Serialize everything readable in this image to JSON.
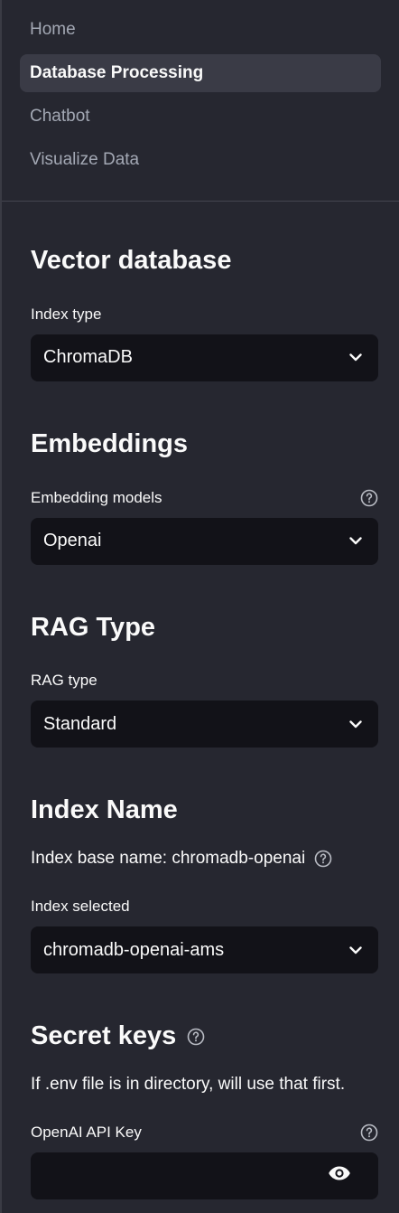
{
  "nav": {
    "items": [
      {
        "label": "Home",
        "active": false
      },
      {
        "label": "Database Processing",
        "active": true
      },
      {
        "label": "Chatbot",
        "active": false
      },
      {
        "label": "Visualize Data",
        "active": false
      }
    ]
  },
  "vector_db": {
    "title": "Vector database",
    "index_type_label": "Index type",
    "index_type_value": "ChromaDB"
  },
  "embeddings": {
    "title": "Embeddings",
    "models_label": "Embedding models",
    "models_value": "Openai"
  },
  "rag": {
    "title": "RAG Type",
    "type_label": "RAG type",
    "type_value": "Standard"
  },
  "index_name": {
    "title": "Index Name",
    "base_name_text": "Index base name: chromadb-openai",
    "selected_label": "Index selected",
    "selected_value": "chromadb-openai-ams"
  },
  "secret_keys": {
    "title": "Secret keys",
    "note": "If .env file is in directory, will use that first.",
    "openai_label": "OpenAI API Key",
    "openai_value": ""
  },
  "icons": {
    "chevron": "chevron-down-icon",
    "help": "question-circle-icon",
    "eye": "eye-icon"
  },
  "colors": {
    "background": "#262730",
    "input_background": "#121218",
    "active_nav": "#3a3b46",
    "muted_text": "#a3a8b4",
    "text": "#fafafa"
  }
}
